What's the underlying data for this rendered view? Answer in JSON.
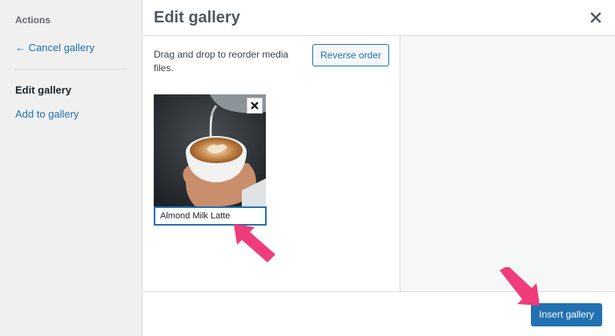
{
  "sidebar": {
    "heading": "Actions",
    "cancel_link": "← Cancel gallery",
    "active_item": "Edit gallery",
    "add_link": "Add to gallery"
  },
  "header": {
    "title": "Edit gallery"
  },
  "main": {
    "instructions": "Drag and drop to reorder media files.",
    "reverse_order_label": "Reverse order",
    "items": [
      {
        "caption": "Almond Milk Latte"
      }
    ]
  },
  "footer": {
    "insert_label": "Insert gallery"
  },
  "colors": {
    "accent": "#2271b1",
    "annotation_arrow": "#ee3d7a"
  }
}
